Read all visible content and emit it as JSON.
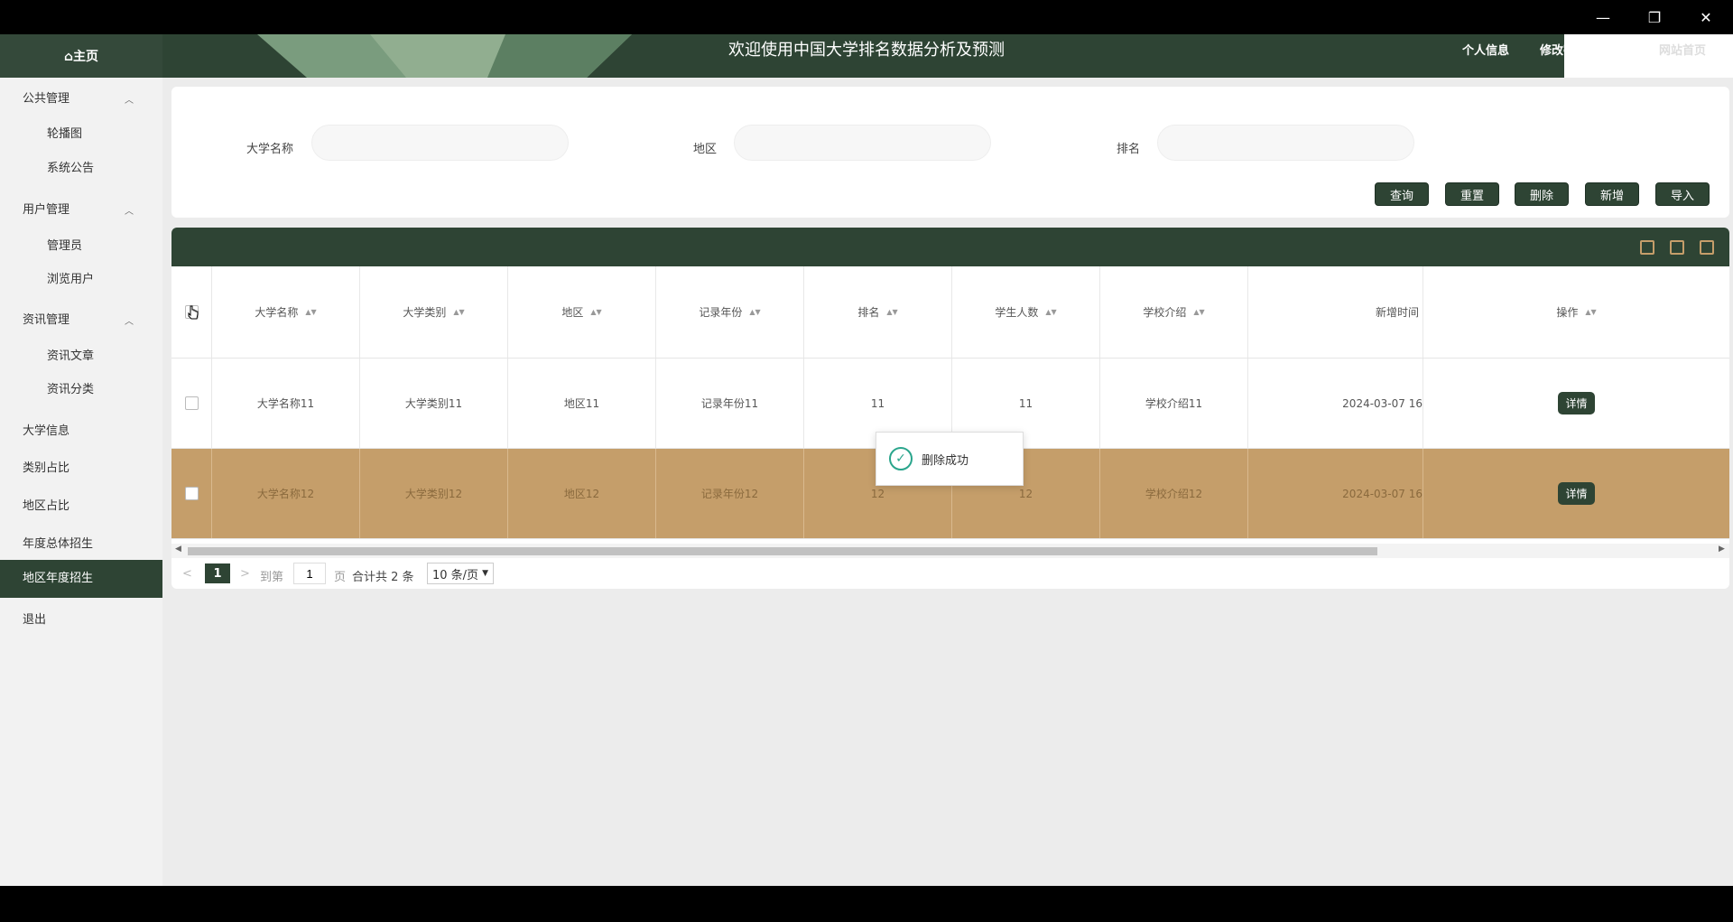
{
  "window": {
    "minimize": "—",
    "maximize": "❐",
    "close": "✕"
  },
  "header": {
    "home": "⌂主页",
    "title": "欢迎使用中国大学排名数据分析及预测",
    "links": [
      "个人信息",
      "修改密码",
      "网站首页"
    ]
  },
  "sidebar": {
    "groups": [
      {
        "label": "公共管理",
        "items": [
          "轮播图",
          "系统公告"
        ]
      },
      {
        "label": "用户管理",
        "items": [
          "管理员",
          "浏览用户"
        ]
      },
      {
        "label": "资讯管理",
        "items": [
          "资讯文章",
          "资讯分类"
        ]
      }
    ],
    "items": [
      "大学信息",
      "类别占比",
      "地区占比",
      "年度总体招生",
      "地区年度招生",
      "退出"
    ],
    "active": "地区年度招生"
  },
  "search": {
    "fields": [
      {
        "label": "大学名称",
        "value": ""
      },
      {
        "label": "地区",
        "value": ""
      },
      {
        "label": "排名",
        "value": ""
      }
    ],
    "buttons": [
      "查询",
      "重置",
      "删除",
      "新增",
      "导入"
    ]
  },
  "table": {
    "columns": [
      "大学名称",
      "大学类别",
      "地区",
      "记录年份",
      "排名",
      "学生人数",
      "学校介绍",
      "新增时间",
      "操作"
    ],
    "rows": [
      [
        "大学名称11",
        "大学类别11",
        "地区11",
        "记录年份11",
        "11",
        "11",
        "学校介绍11",
        "2024-03-07 16",
        "详情"
      ],
      [
        "大学名称12",
        "大学类别12",
        "地区12",
        "记录年份12",
        "12",
        "12",
        "学校介绍12",
        "2024-03-07 16",
        "详情"
      ]
    ],
    "highlight_color": "#c59e6a"
  },
  "pager": {
    "prev": "<",
    "current": "1",
    "next": ">",
    "goto_prefix": "到第",
    "goto_value": "1",
    "goto_suffix": "页",
    "total": "合计共 2 条",
    "page_size": "10 条/页"
  },
  "toast": {
    "text": "删除成功"
  },
  "colors": {
    "primary": "#2e4434",
    "accent": "#c59e6a",
    "success": "#2aa58c"
  }
}
